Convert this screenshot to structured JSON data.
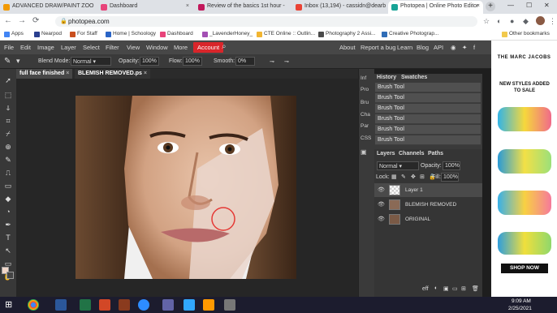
{
  "browser": {
    "tabs": [
      {
        "title": "ADVANCED DRAW/PAINT ZOO",
        "color": "#f29900"
      },
      {
        "title": "Dashboard",
        "color": "#e8437a"
      },
      {
        "title": "Review of the basics 1st hour -",
        "color": "#c2185b"
      },
      {
        "title": "Inbox (13,194) - cassidn@dearb",
        "color": "#ea4335"
      },
      {
        "title": "Photopea | Online Photo Editor",
        "color": "#18a497"
      }
    ],
    "tab_close": "×",
    "new_tab": "+",
    "window_buttons": [
      "—",
      "☐",
      "✕"
    ],
    "url": "photopea.com",
    "bookmarks": [
      {
        "label": "Apps",
        "color": "#4285f4"
      },
      {
        "label": "Nearpod",
        "color": "#2a3f8f"
      },
      {
        "label": "For Staff",
        "color": "#c94f1e"
      },
      {
        "label": "Home | Schoology",
        "color": "#2a64c6"
      },
      {
        "label": "Dashboard",
        "color": "#e8437a"
      },
      {
        "label": "_LavenderHoney_",
        "color": "#a34fb3"
      },
      {
        "label": "CTE Online :: Outlin...",
        "color": "#f2b531"
      },
      {
        "label": "Photography 2 Assi...",
        "color": "#4a4a4a"
      },
      {
        "label": "Creative Photograp...",
        "color": "#2f6db7"
      }
    ],
    "other_bookmarks": "Other bookmarks"
  },
  "photopea": {
    "menu": [
      "File",
      "Edit",
      "Image",
      "Layer",
      "Select",
      "Filter",
      "View",
      "Window",
      "More"
    ],
    "account": "Account",
    "menu_right": [
      "About",
      "Report a bug",
      "Learn",
      "Blog",
      "API"
    ],
    "options": {
      "blend_mode_label": "Blend Mode:",
      "blend_mode_value": "Normal",
      "opacity_label": "Opacity:",
      "opacity_value": "100%",
      "flow_label": "Flow:",
      "flow_value": "100%",
      "smooth_label": "Smooth:",
      "smooth_value": "0%"
    },
    "doc_tabs": [
      "full face finished",
      "BLEMISH REMOVED.ps"
    ],
    "side_tabs": [
      "Inf",
      "Pro",
      "Bru",
      "Cha",
      "Par",
      "CSS"
    ],
    "history": {
      "tabs": [
        "History",
        "Swatches"
      ],
      "items": [
        "Brush Tool",
        "Brush Tool",
        "Brush Tool",
        "Brush Tool",
        "Brush Tool",
        "Brush Tool",
        "Brush Tool"
      ]
    },
    "layers": {
      "tabs": [
        "Layers",
        "Channels",
        "Paths"
      ],
      "blend": "Normal",
      "opacity_label": "Opacity:",
      "opacity_value": "100%",
      "lock_label": "Lock:",
      "fill_label": "Fill:",
      "fill_value": "100%",
      "items": [
        "Layer 1",
        "BLEMISH REMOVED",
        "ORIGINAL"
      ],
      "footer_label": "eff"
    }
  },
  "ad": {
    "brand": "THE MARC JACOBS",
    "headline": "NEW STYLES ADDED TO SALE",
    "cta": "SHOP NOW"
  },
  "taskbar": {
    "time": "9:09 AM",
    "date": "2/25/2021"
  }
}
